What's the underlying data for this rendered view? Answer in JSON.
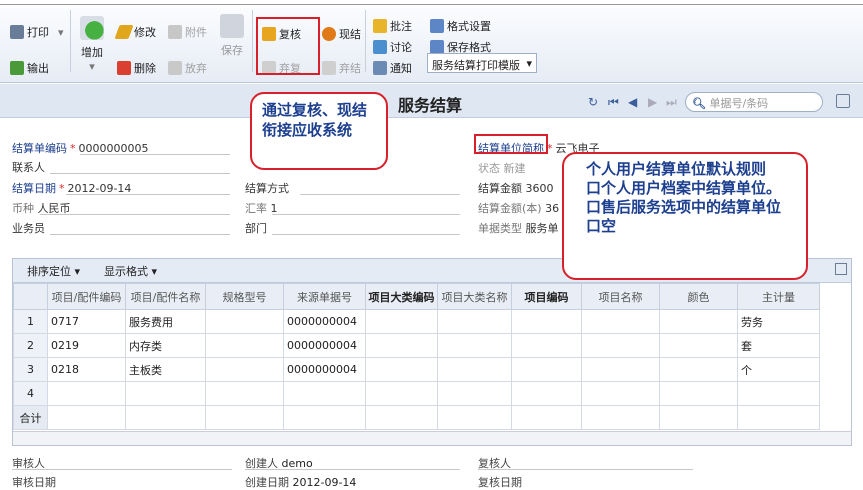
{
  "toolbar": {
    "print": "打印",
    "export": "输出",
    "add": "增加",
    "modify": "修改",
    "attach": "附件",
    "delete": "删除",
    "abandon": "放弃",
    "save": "保存",
    "review": "复核",
    "cash_settle": "现结",
    "unreview": "弃复",
    "unsettle": "弃结",
    "annotate": "批注",
    "discuss": "讨论",
    "notify": "通知",
    "format_settings": "格式设置",
    "save_format": "保存格式",
    "print_template": "服务结算打印模版"
  },
  "page": {
    "title": "服务结算",
    "search_placeholder": "单据号/条码"
  },
  "form": {
    "bill_no_label": "结算单编码",
    "bill_no": "0000000005",
    "contact_label": "联系人",
    "date_label": "结算日期",
    "date": "2012-09-14",
    "currency_label": "币种",
    "currency": "人民币",
    "salesman_label": "业务员",
    "method_label": "结算方式",
    "rate_label": "汇率",
    "rate": "1",
    "dept_label": "部门",
    "unit_label": "结算单位简称",
    "unit": "云飞电子",
    "status_label": "状态",
    "status": "新建",
    "amount_label": "结算金额",
    "amount": "3600",
    "amount_local_label": "结算金额(本)",
    "amount_local": "36",
    "bill_type_label": "单据类型",
    "bill_type": "服务单"
  },
  "grid": {
    "sort_label": "排序定位",
    "display_label": "显示格式",
    "columns": [
      "项目/配件编码",
      "项目/配件名称",
      "规格型号",
      "来源单据号",
      "项目大类编码",
      "项目大类名称",
      "项目编码",
      "项目名称",
      "颜色",
      "主计量"
    ],
    "rows": [
      {
        "no": "1",
        "code": "0717",
        "name": "服务费用",
        "src": "0000000004",
        "unit": "劳务"
      },
      {
        "no": "2",
        "code": "0219",
        "name": "内存类",
        "src": "0000000004",
        "unit": "套"
      },
      {
        "no": "3",
        "code": "0218",
        "name": "主板类",
        "src": "0000000004",
        "unit": "个"
      },
      {
        "no": "4",
        "code": "",
        "name": "",
        "src": "",
        "unit": ""
      }
    ],
    "total_label": "合计"
  },
  "footer": {
    "auditor_label": "审核人",
    "audit_date_label": "审核日期",
    "creator_label": "创建人",
    "creator": "demo",
    "create_date_label": "创建日期",
    "create_date": "2012-09-14",
    "reviewer_label": "复核人",
    "review_date_label": "复核日期"
  },
  "callouts": {
    "review_note": "通过复核、现结衔接应收系统",
    "rule_lines": [
      "个人用户结算单位默认规则",
      "口个人用户档案中结算单位。",
      "口售后服务选项中的结算单位",
      "口空"
    ]
  },
  "colors": {
    "accent_red": "#d8202a",
    "callout_text": "#1d3f8f"
  }
}
